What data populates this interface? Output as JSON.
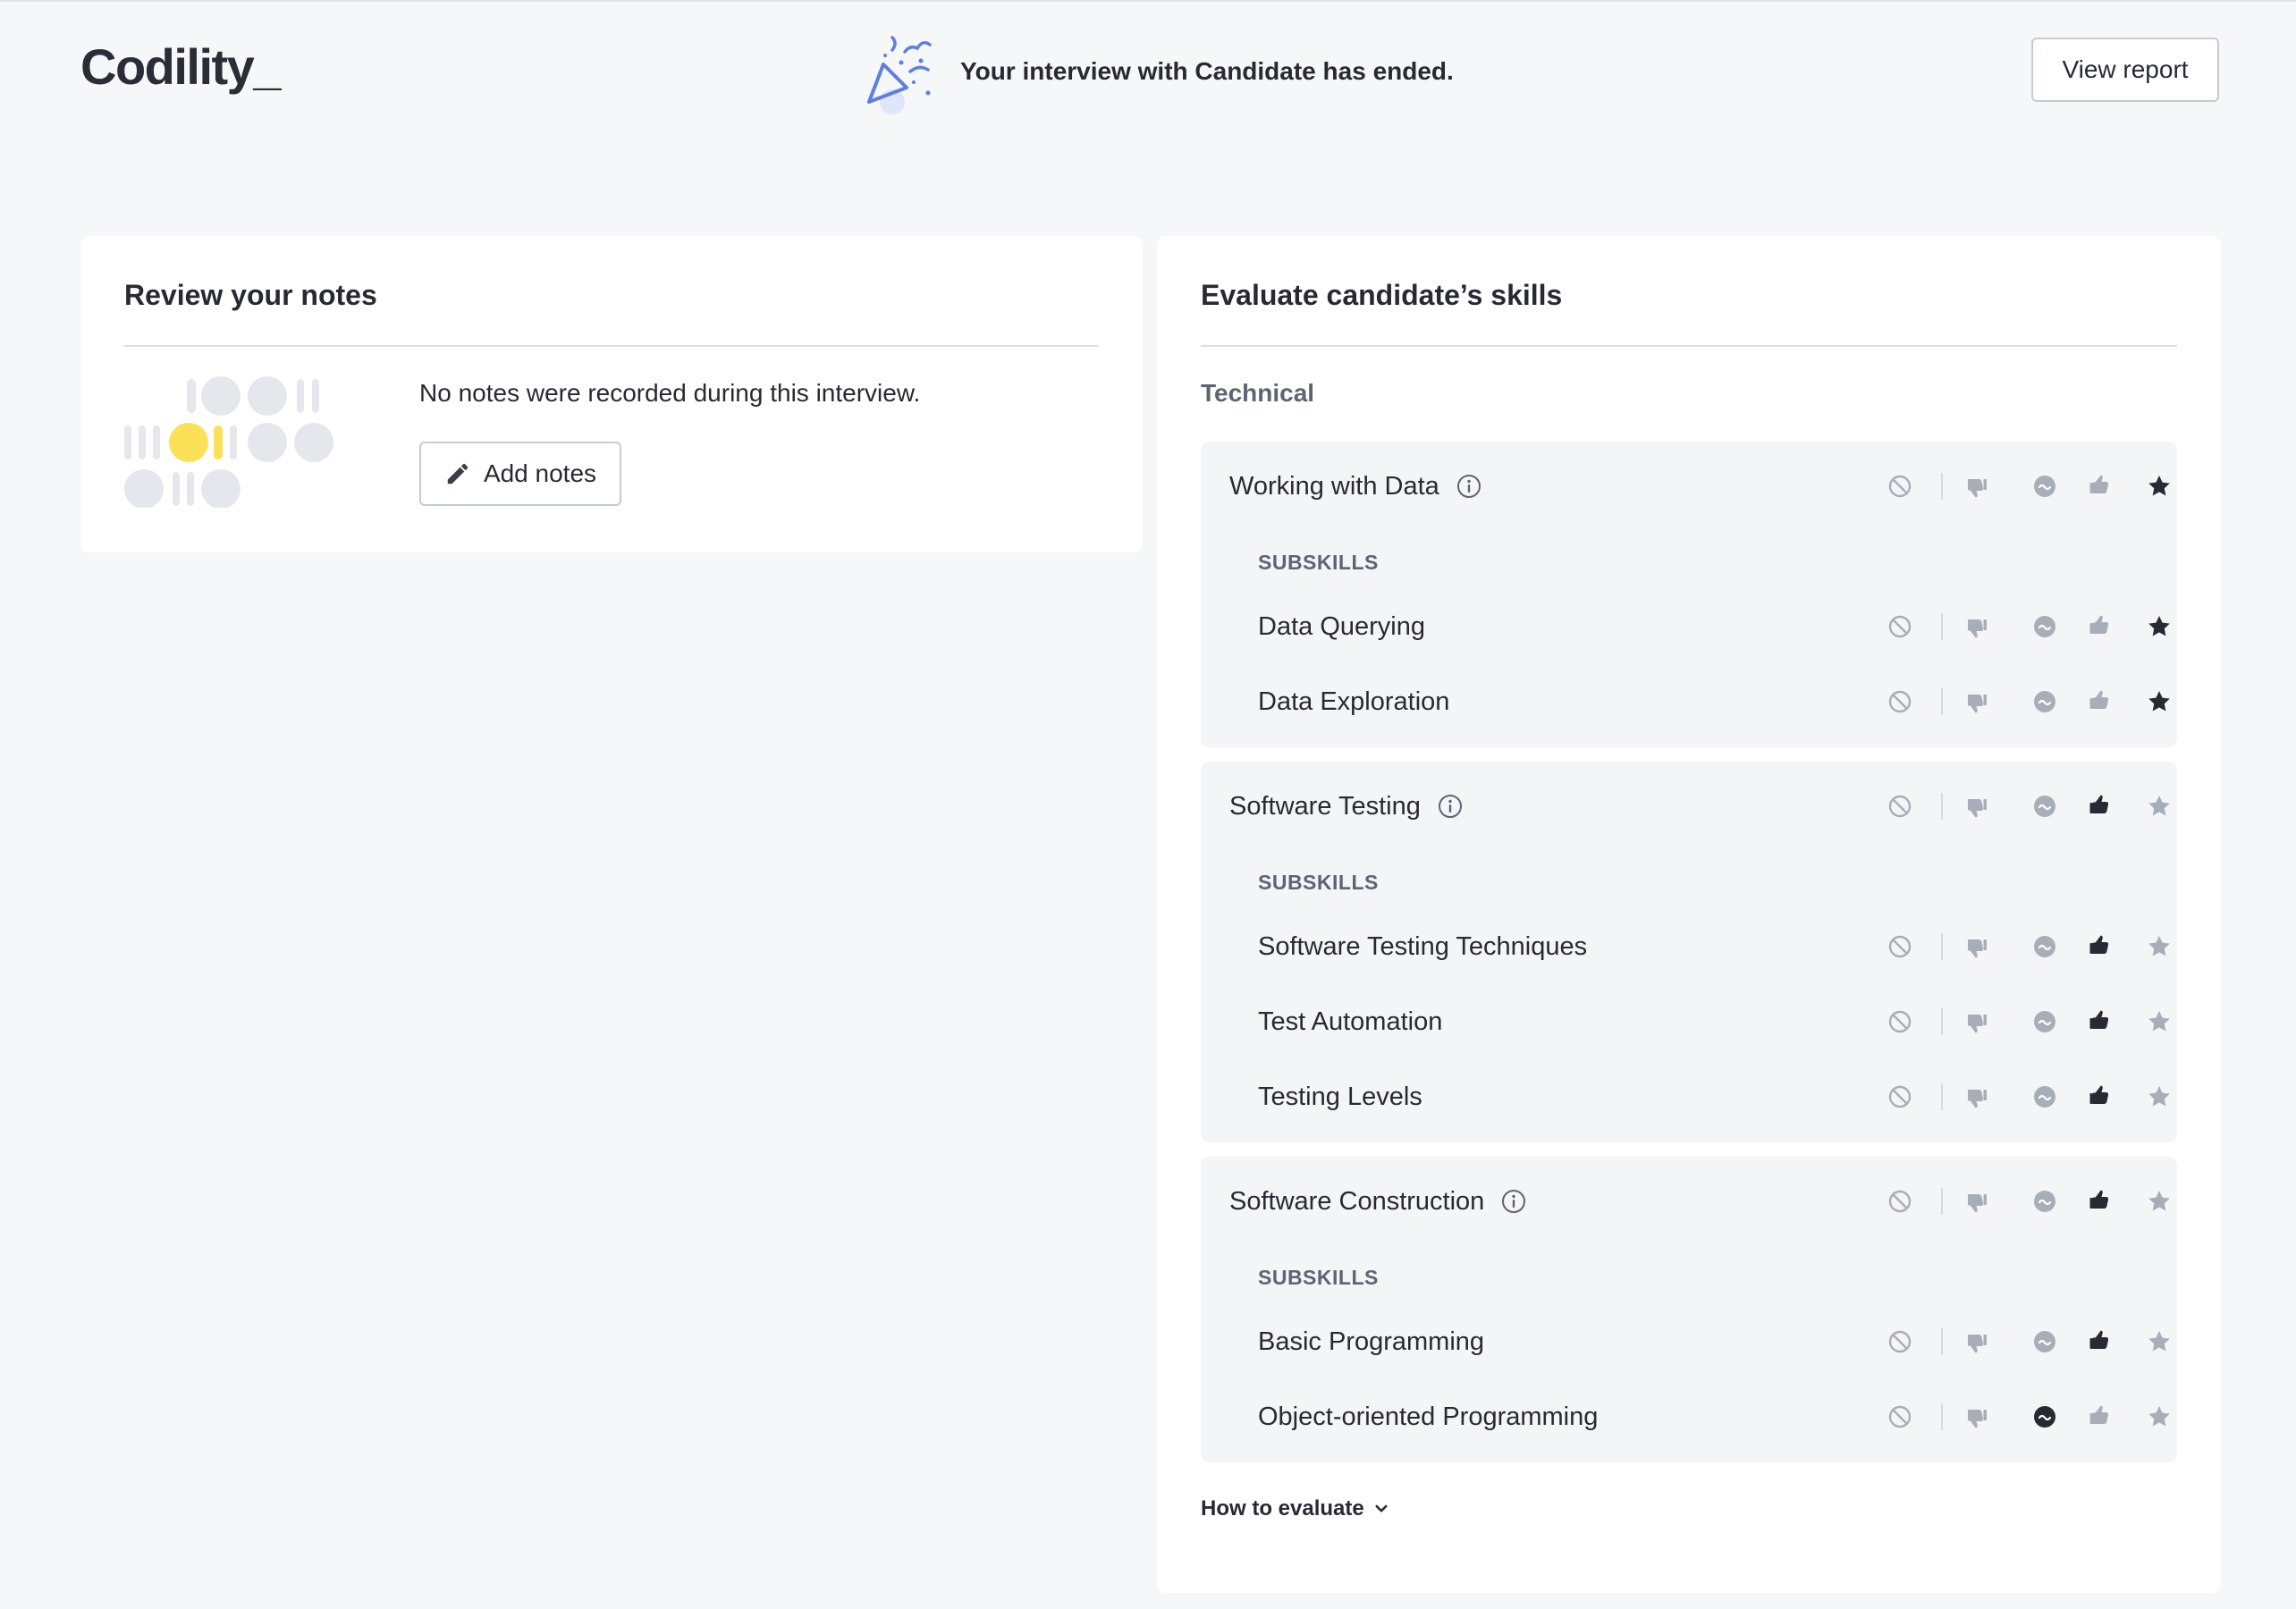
{
  "header": {
    "logo": "Codility_",
    "banner_text": "Your interview with Candidate has ended.",
    "view_report_label": "View report"
  },
  "notes": {
    "title": "Review your notes",
    "empty_text": "No notes were recorded during this interview.",
    "add_label": "Add notes"
  },
  "skills": {
    "title": "Evaluate candidate’s skills",
    "section": "Technical",
    "subskills_label": "SUBSKILLS",
    "how_to_evaluate": "How to evaluate",
    "rating_scale": [
      "not-evaluated",
      "thumbs-down",
      "neutral",
      "thumbs-up",
      "star"
    ],
    "groups": [
      {
        "name": "Working with Data",
        "rating": "star",
        "subskills": [
          {
            "name": "Data Querying",
            "rating": "star"
          },
          {
            "name": "Data Exploration",
            "rating": "star"
          }
        ]
      },
      {
        "name": "Software Testing",
        "rating": "thumbs-up",
        "subskills": [
          {
            "name": "Software Testing Techniques",
            "rating": "thumbs-up"
          },
          {
            "name": "Test Automation",
            "rating": "thumbs-up"
          },
          {
            "name": "Testing Levels",
            "rating": "thumbs-up"
          }
        ]
      },
      {
        "name": "Software Construction",
        "rating": "thumbs-up",
        "subskills": [
          {
            "name": "Basic Programming",
            "rating": "thumbs-up"
          },
          {
            "name": "Object-oriented Programming",
            "rating": "neutral"
          }
        ]
      }
    ]
  },
  "colors": {
    "background": "#f6f7f9",
    "card": "#ffffff",
    "group_bg": "#f4f5f7",
    "text": "#272a33",
    "muted": "#5d6472",
    "icon_inactive": "#a8aeb8",
    "icon_active": "#272a33",
    "accent_blue": "#5f7fe0",
    "accent_yellow": "#fbe157"
  }
}
